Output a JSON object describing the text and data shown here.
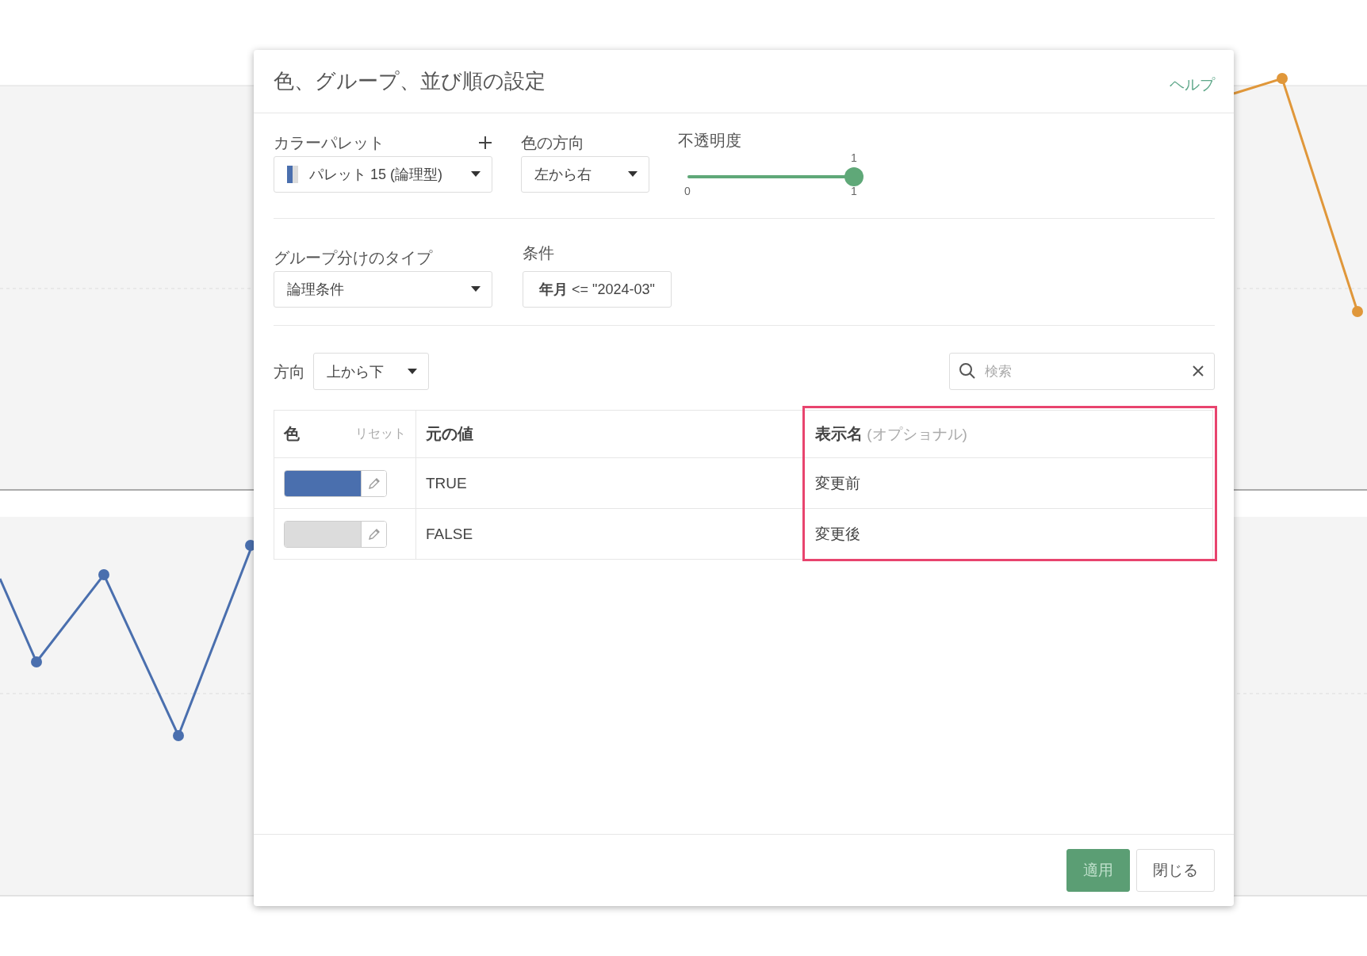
{
  "dialog": {
    "title": "色、グループ、並び順の設定",
    "help_link": "ヘルプ"
  },
  "color_palette": {
    "label": "カラーパレット",
    "value": "パレット 15 (論理型)"
  },
  "color_direction": {
    "label": "色の方向",
    "value": "左から右"
  },
  "opacity": {
    "label": "不透明度",
    "level": 1,
    "min_label": "0",
    "max_label": "1",
    "value_label": "1"
  },
  "grouping_type": {
    "label": "グループ分けのタイプ",
    "value": "論理条件"
  },
  "condition": {
    "label": "条件",
    "value": "**年月** <= \"2024-03\""
  },
  "sort_direction": {
    "label": "方向",
    "value": "上から下"
  },
  "search": {
    "placeholder": "検索"
  },
  "table": {
    "columns": [
      {
        "label": "色",
        "action": "リセット",
        "highlighted": false
      },
      {
        "label": "元の値",
        "highlighted": false
      },
      {
        "label": "表示名",
        "hint": "(オプショナル)",
        "highlighted": true
      }
    ],
    "rows": [
      {
        "color": "#4a6fae",
        "value": "TRUE",
        "display_name": "変更前"
      },
      {
        "color": "#dcdcdc",
        "value": "FALSE",
        "display_name": "変更後"
      }
    ]
  },
  "buttons": [
    {
      "label": "適用",
      "kind": "primary"
    },
    {
      "label": "閉じる",
      "kind": "secondary"
    }
  ]
}
